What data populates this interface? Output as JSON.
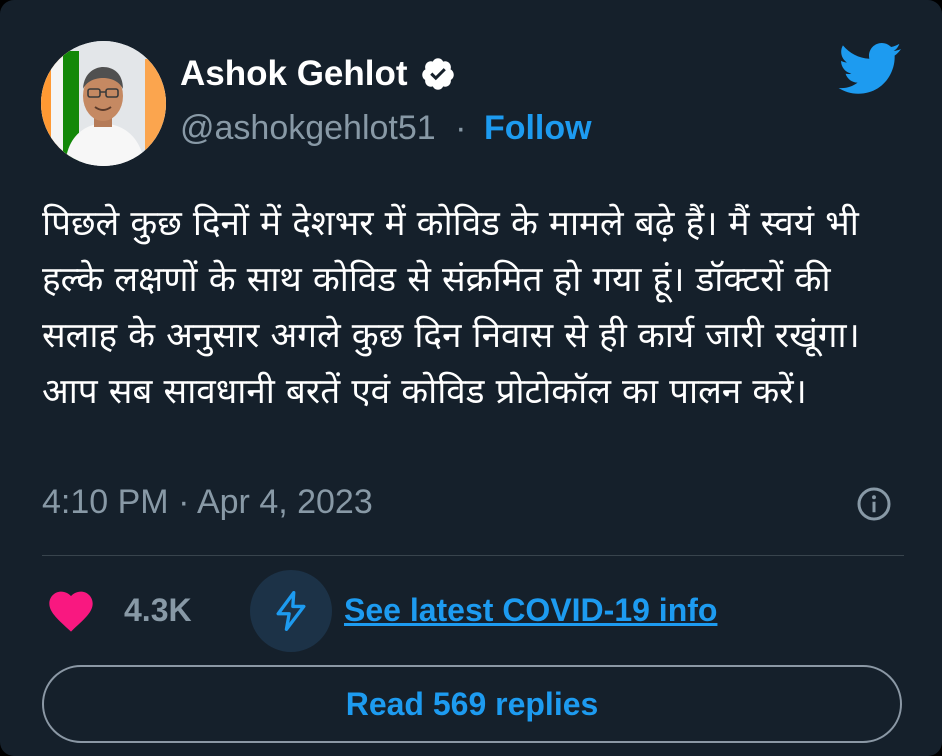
{
  "author": {
    "name": "Ashok Gehlot",
    "handle": "@ashokgehlot51",
    "separator": "·",
    "follow_label": "Follow",
    "verified_icon": "verified-badge-icon",
    "avatar": "profile-photo"
  },
  "brand": {
    "logo": "twitter-bird-icon",
    "accent_color": "#1d9bf0",
    "background_color": "#15202b",
    "text_color": "#ffffff",
    "muted_color": "#8899a6"
  },
  "tweet": {
    "text": "पिछले कुछ दिनों में देशभर में कोविड के मामले बढ़े हैं। मैं स्वयं भी हल्के लक्षणों के साथ कोविड से संक्रमित हो गया हूं। डॉक्टरों की सलाह के अनुसार अगले कुछ दिन निवास से ही कार्य जारी रखूंगा। आप सब सावधानी बरतें एवं कोविड प्रोटोकॉल का पालन करें।",
    "timestamp": "4:10 PM · Apr 4, 2023",
    "info_icon": "info-icon"
  },
  "actions": {
    "like_icon": "heart-icon",
    "like_color": "#f91880",
    "like_count": "4.3K",
    "covid_icon": "lightning-bolt-icon",
    "covid_link_label": "See latest COVID-19 info",
    "read_replies_label": "Read 569 replies"
  }
}
